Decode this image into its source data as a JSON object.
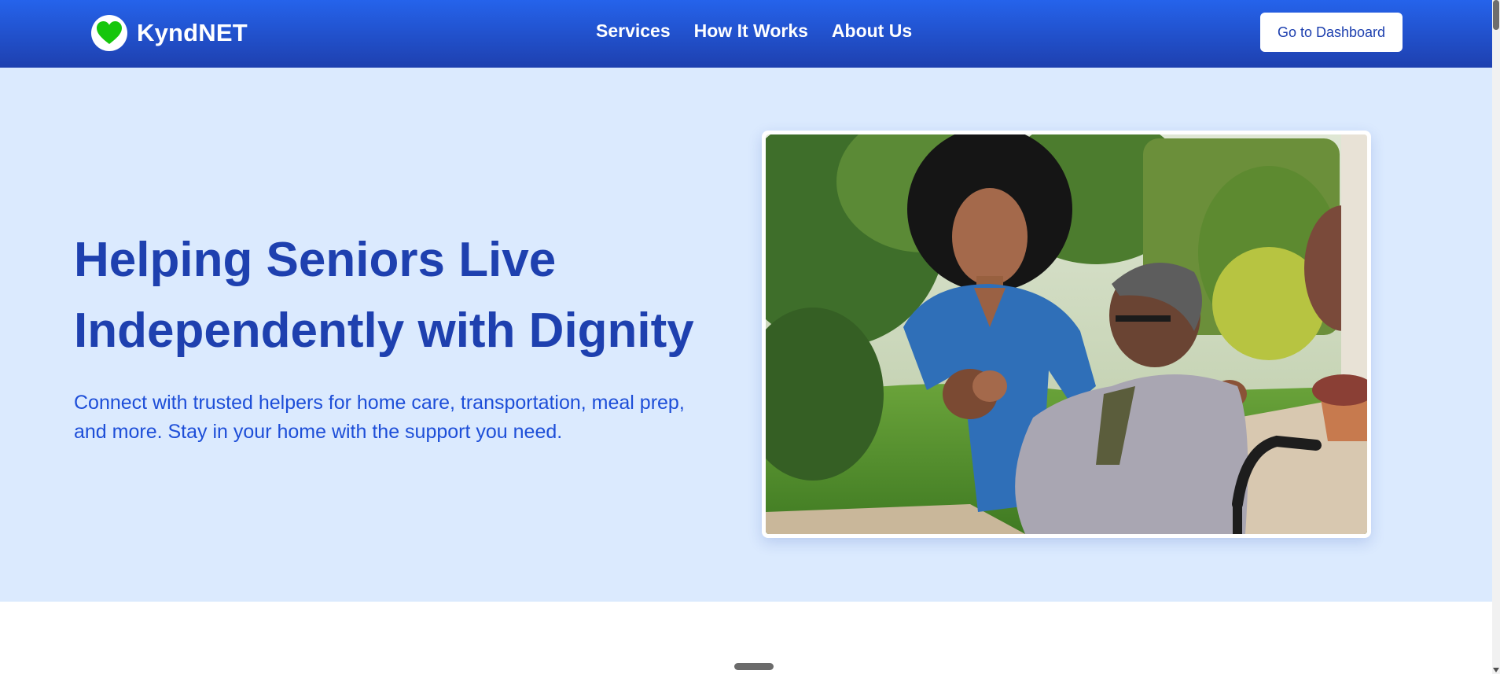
{
  "app": {
    "brand_name": "KyndNET",
    "logo_icon": "heart-icon",
    "colors": {
      "header_start": "#2563eb",
      "header_end": "#1e40af",
      "hero_bg": "#dbeafe",
      "title": "#1e40af",
      "logo_heart": "#22c55e"
    }
  },
  "nav": {
    "links": [
      {
        "label": "Services"
      },
      {
        "label": "How It Works"
      },
      {
        "label": "About Us"
      }
    ],
    "dashboard_button": "Go to Dashboard"
  },
  "hero": {
    "title_line1": "Helping Seniors Live",
    "title_line2": "Independently with Dignity",
    "subtitle_line1": "Connect with trusted helpers for home care, transportation, meal prep,",
    "subtitle_line2": "and more. Stay in your home with the support you need.",
    "image_icon": "caregiver-photo"
  },
  "scroll": {
    "position_fraction": 0.0
  }
}
